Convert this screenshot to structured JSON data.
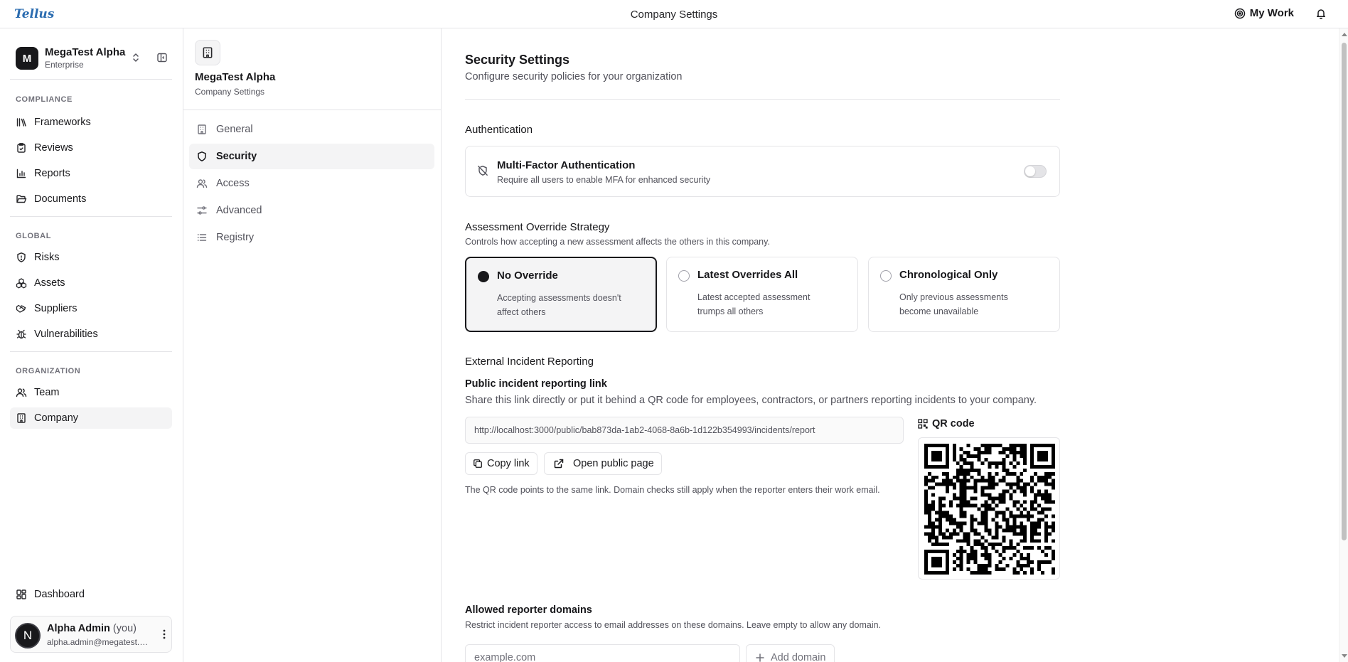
{
  "topbar": {
    "logo": "Tellus",
    "title": "Company Settings",
    "my_work": "My Work"
  },
  "sidebar": {
    "org_initial": "M",
    "org_name": "MegaTest Alpha",
    "org_plan": "Enterprise",
    "sections": [
      {
        "label": "COMPLIANCE",
        "items": [
          "Frameworks",
          "Reviews",
          "Reports",
          "Documents"
        ]
      },
      {
        "label": "GLOBAL",
        "items": [
          "Risks",
          "Assets",
          "Suppliers",
          "Vulnerabilities"
        ]
      },
      {
        "label": "ORGANIZATION",
        "items": [
          "Team",
          "Company"
        ]
      }
    ],
    "dashboard": "Dashboard",
    "user": {
      "initial": "N",
      "name": "Alpha Admin",
      "you": "(you)",
      "email": "alpha.admin@megatest.com"
    }
  },
  "subnav": {
    "title": "MegaTest Alpha",
    "subtitle": "Company Settings",
    "items": [
      "General",
      "Security",
      "Access",
      "Advanced",
      "Registry"
    ]
  },
  "main": {
    "title": "Security Settings",
    "subtitle": "Configure security policies for your organization",
    "auth": {
      "title": "Authentication",
      "mfa_title": "Multi-Factor Authentication",
      "mfa_desc": "Require all users to enable MFA for enhanced security",
      "mfa_enabled": false
    },
    "strategy": {
      "title": "Assessment Override Strategy",
      "desc": "Controls how accepting a new assessment affects the others in this company.",
      "selected": 0,
      "options": [
        {
          "label": "No Override",
          "desc": "Accepting assessments doesn't affect others"
        },
        {
          "label": "Latest Overrides All",
          "desc": "Latest accepted assessment trumps all others"
        },
        {
          "label": "Chronological Only",
          "desc": "Only previous assessments become unavailable"
        }
      ]
    },
    "external": {
      "title": "External Incident Reporting",
      "link_title": "Public incident reporting link",
      "link_desc": "Share this link directly or put it behind a QR code for employees, contractors, or partners reporting incidents to your company.",
      "url": "http://localhost:3000/public/bab873da-1ab2-4068-8a6b-1d122b354993/incidents/report",
      "copy_label": "Copy link",
      "open_label": "Open public page",
      "note": "The QR code points to the same link. Domain checks still apply when the reporter enters their work email.",
      "qr_label": "QR code"
    },
    "domains": {
      "title": "Allowed reporter domains",
      "desc": "Restrict incident reporter access to email addresses on these domains. Leave empty to allow any domain.",
      "placeholder": "example.com",
      "add_label": "Add domain"
    }
  }
}
